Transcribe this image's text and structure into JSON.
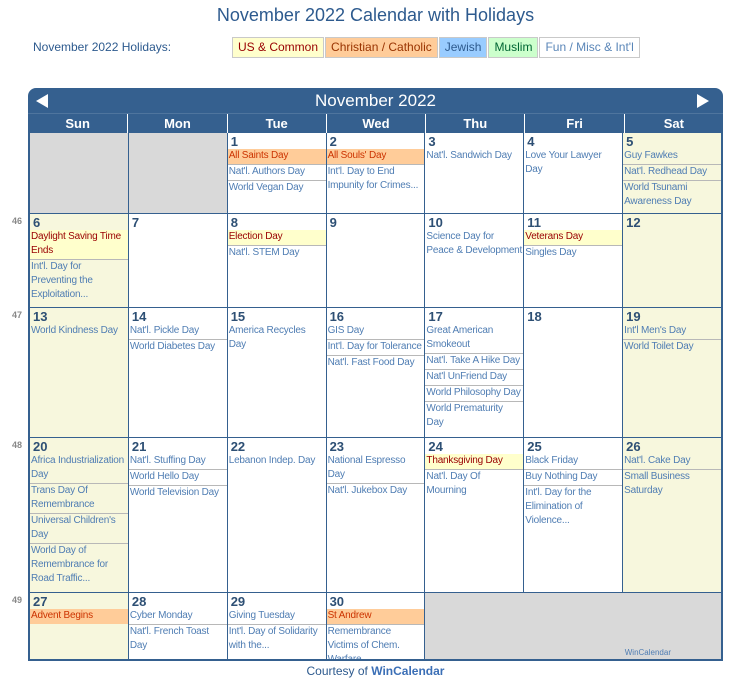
{
  "title": "November 2022 Calendar with Holidays",
  "legend": {
    "label": "November 2022 Holidays:",
    "items": [
      {
        "key": "us",
        "label": "US & Common",
        "color": "#ffffcc"
      },
      {
        "key": "chr",
        "label": "Christian / Catholic",
        "color": "#ffcc99"
      },
      {
        "key": "jew",
        "label": "Jewish",
        "color": "#99ccff"
      },
      {
        "key": "mus",
        "label": "Muslim",
        "color": "#ccffcc"
      },
      {
        "key": "fun",
        "label": "Fun / Misc & Int'l",
        "color": "#ffffff"
      }
    ]
  },
  "calendar": {
    "month_label": "November 2022",
    "prev_icon": "triangle-left-icon",
    "next_icon": "triangle-right-icon",
    "days_of_week": [
      "Sun",
      "Mon",
      "Tue",
      "Wed",
      "Thu",
      "Fri",
      "Sat"
    ],
    "week_numbers": [
      "46",
      "47",
      "48",
      "49"
    ],
    "watermark": "WinCalendar",
    "weeks": [
      [
        {
          "empty": true
        },
        {
          "empty": true
        },
        {
          "day": "1",
          "events": [
            {
              "t": "All Saints Day",
              "c": "chr"
            },
            {
              "t": "Nat'l. Authors Day"
            },
            {
              "t": "World Vegan Day"
            }
          ]
        },
        {
          "day": "2",
          "events": [
            {
              "t": "All Souls' Day",
              "c": "chr"
            },
            {
              "t": "Int'l. Day to End Impunity for Crimes..."
            }
          ]
        },
        {
          "day": "3",
          "events": [
            {
              "t": "Nat'l. Sandwich Day"
            }
          ]
        },
        {
          "day": "4",
          "events": [
            {
              "t": "Love Your Lawyer Day"
            }
          ]
        },
        {
          "day": "5",
          "weekend": true,
          "events": [
            {
              "t": "Guy Fawkes"
            },
            {
              "t": "Nat'l. Redhead Day"
            },
            {
              "t": "World Tsunami Awareness Day"
            }
          ]
        }
      ],
      [
        {
          "day": "6",
          "weekend": true,
          "events": [
            {
              "t": "Daylight Saving Time Ends",
              "c": "us"
            },
            {
              "t": "Int'l. Day for Preventing the Exploitation..."
            }
          ]
        },
        {
          "day": "7",
          "events": []
        },
        {
          "day": "8",
          "events": [
            {
              "t": "Election Day",
              "c": "us"
            },
            {
              "t": "Nat'l. STEM Day"
            }
          ]
        },
        {
          "day": "9",
          "events": []
        },
        {
          "day": "10",
          "events": [
            {
              "t": "Science Day for Peace & Development"
            }
          ]
        },
        {
          "day": "11",
          "events": [
            {
              "t": "Veterans Day",
              "c": "us"
            },
            {
              "t": "Singles Day"
            }
          ]
        },
        {
          "day": "12",
          "weekend": true,
          "events": []
        }
      ],
      [
        {
          "day": "13",
          "weekend": true,
          "events": [
            {
              "t": "World Kindness Day"
            }
          ]
        },
        {
          "day": "14",
          "events": [
            {
              "t": "Nat'l. Pickle Day"
            },
            {
              "t": "World Diabetes Day"
            }
          ]
        },
        {
          "day": "15",
          "events": [
            {
              "t": "America Recycles Day"
            }
          ]
        },
        {
          "day": "16",
          "events": [
            {
              "t": "GIS Day"
            },
            {
              "t": "Int'l. Day for Tolerance"
            },
            {
              "t": "Nat'l. Fast Food Day"
            }
          ]
        },
        {
          "day": "17",
          "events": [
            {
              "t": "Great American Smokeout"
            },
            {
              "t": "Nat'l. Take A Hike Day"
            },
            {
              "t": "Nat'l UnFriend Day"
            },
            {
              "t": "World Philosophy Day"
            },
            {
              "t": "World Prematurity Day"
            }
          ]
        },
        {
          "day": "18",
          "events": []
        },
        {
          "day": "19",
          "weekend": true,
          "events": [
            {
              "t": "Int'l Men's Day"
            },
            {
              "t": "World Toilet Day"
            }
          ]
        }
      ],
      [
        {
          "day": "20",
          "weekend": true,
          "events": [
            {
              "t": "Africa Industrialization Day"
            },
            {
              "t": "Trans Day Of Remembrance"
            },
            {
              "t": "Universal Children's Day"
            },
            {
              "t": "World Day of Remembrance for Road Traffic..."
            }
          ]
        },
        {
          "day": "21",
          "events": [
            {
              "t": "Nat'l. Stuffing Day"
            },
            {
              "t": "World Hello Day"
            },
            {
              "t": "World Television Day"
            }
          ]
        },
        {
          "day": "22",
          "events": [
            {
              "t": "Lebanon Indep. Day"
            }
          ]
        },
        {
          "day": "23",
          "events": [
            {
              "t": "National Espresso Day"
            },
            {
              "t": "Nat'l. Jukebox Day"
            }
          ]
        },
        {
          "day": "24",
          "events": [
            {
              "t": "Thanksgiving Day",
              "c": "us"
            },
            {
              "t": "Nat'l. Day Of Mourning"
            }
          ]
        },
        {
          "day": "25",
          "events": [
            {
              "t": "Black Friday"
            },
            {
              "t": "Buy Nothing Day"
            },
            {
              "t": "Int'l. Day for the Elimination of Violence..."
            }
          ]
        },
        {
          "day": "26",
          "weekend": true,
          "events": [
            {
              "t": "Nat'l. Cake Day"
            },
            {
              "t": "Small Business Saturday"
            }
          ]
        }
      ],
      [
        {
          "day": "27",
          "weekend": true,
          "events": [
            {
              "t": "Advent Begins",
              "c": "chr"
            }
          ]
        },
        {
          "day": "28",
          "events": [
            {
              "t": "Cyber Monday"
            },
            {
              "t": "Nat'l. French Toast Day"
            }
          ]
        },
        {
          "day": "29",
          "events": [
            {
              "t": "Giving Tuesday"
            },
            {
              "t": "Int'l. Day of Solidarity with the..."
            }
          ]
        },
        {
          "day": "30",
          "events": [
            {
              "t": "St Andrew",
              "c": "chr"
            },
            {
              "t": "Remembrance Victims of Chem. Warfare"
            }
          ]
        },
        {
          "empty": true,
          "span": 3,
          "watermark": true
        }
      ]
    ]
  },
  "footer": {
    "prefix": "Courtesy of ",
    "link": "WinCalendar"
  }
}
